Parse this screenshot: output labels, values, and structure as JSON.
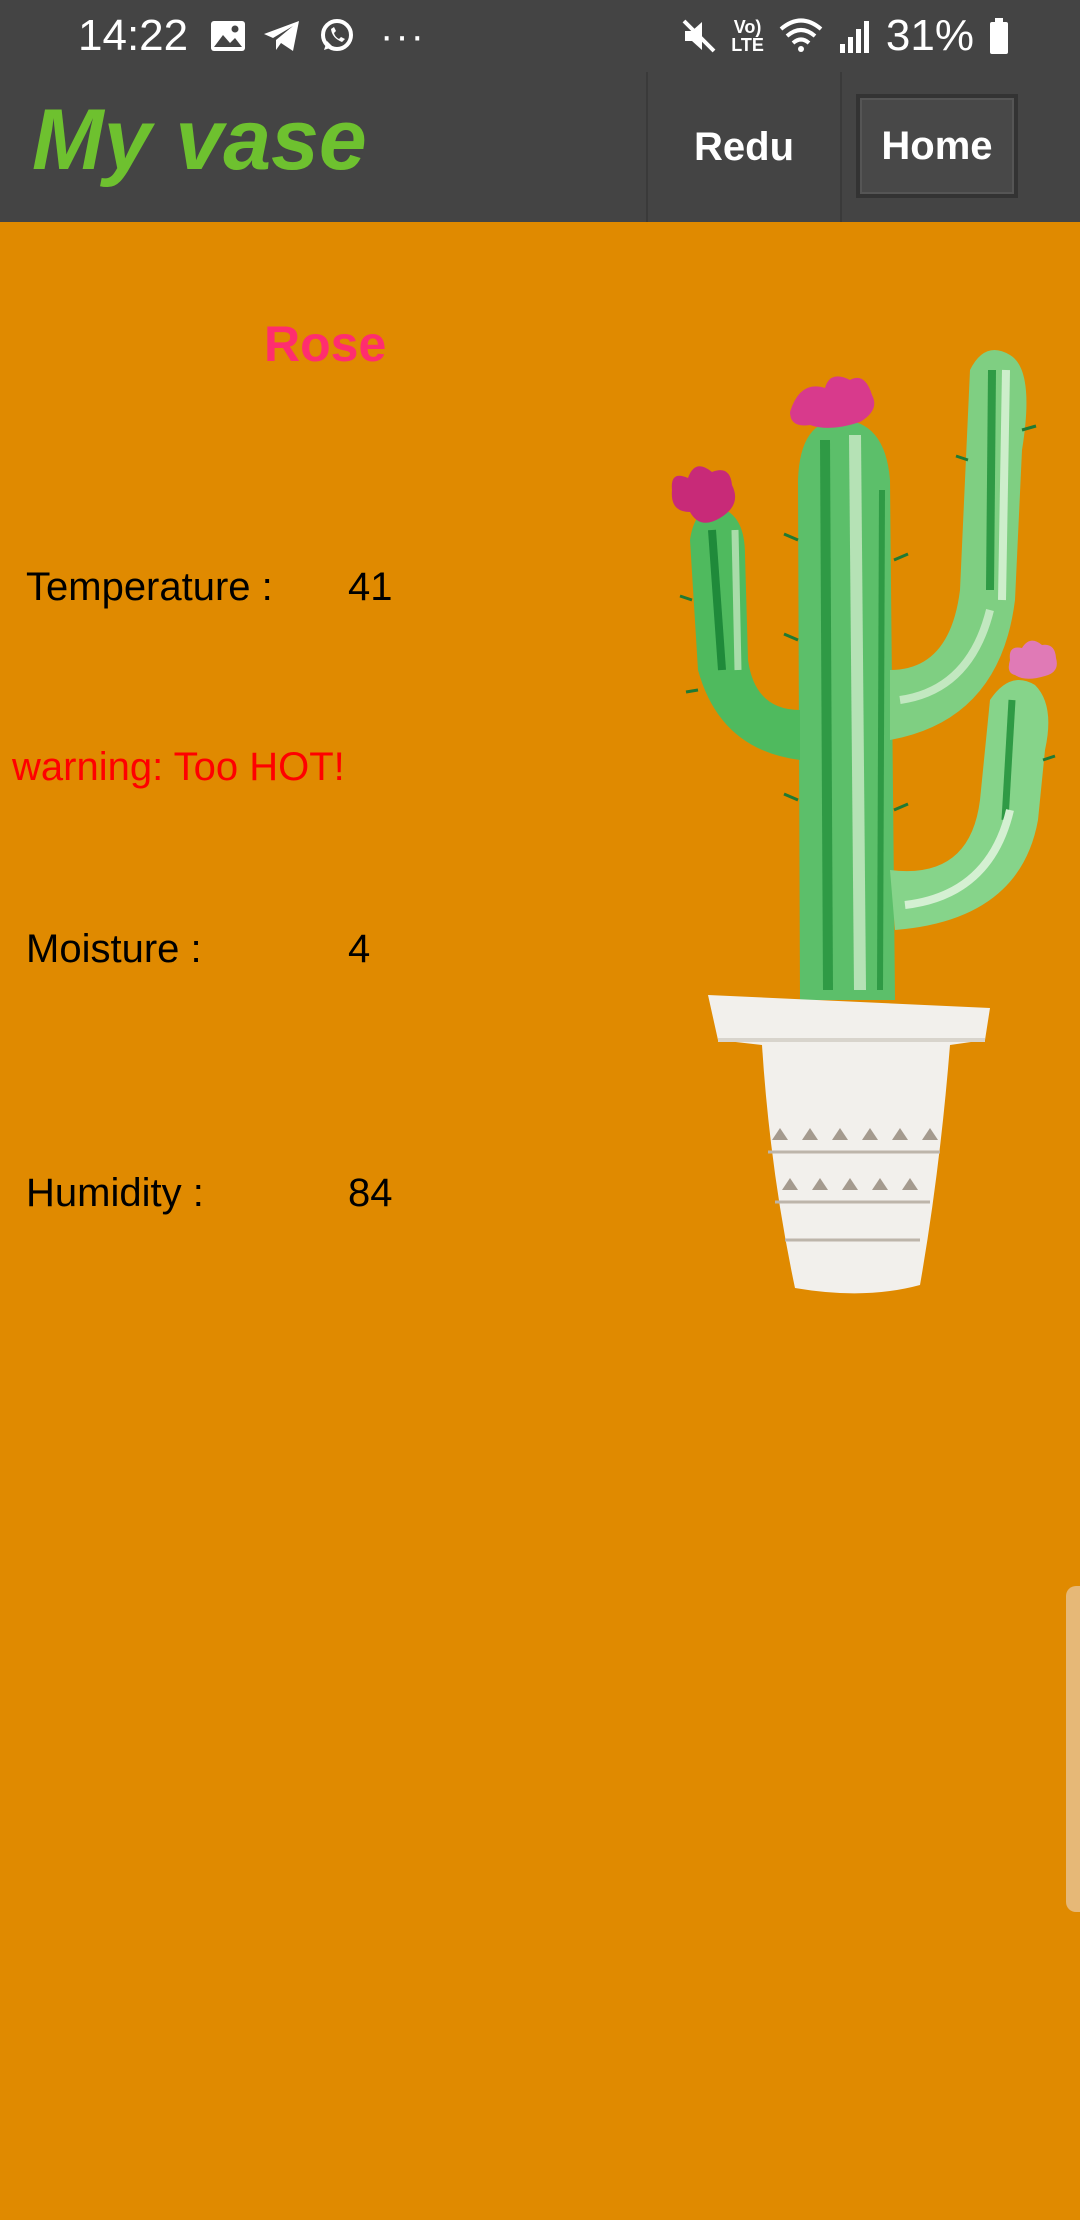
{
  "status_bar": {
    "time": "14:22",
    "left_icons": [
      "image-icon",
      "telegram-icon",
      "whatsapp-icon"
    ],
    "more": "···",
    "right_icons": [
      "mute-icon",
      "volte-icon",
      "wifi-icon",
      "signal-icon",
      "battery-icon"
    ],
    "volte_top": "Vo)",
    "volte_bottom": "LTE",
    "battery_percent": "31%"
  },
  "app_bar": {
    "title": "My vase",
    "buttons": [
      "Redu",
      "Home"
    ]
  },
  "plant": {
    "name": "Rose",
    "image": "cactus-in-pot-illustration"
  },
  "readings": [
    {
      "label": "Temperature :",
      "value": "41"
    },
    {
      "label": "Moisture :",
      "value": "4"
    },
    {
      "label": "Humidity :",
      "value": "84"
    }
  ],
  "warning": "warning: Too HOT!",
  "colors": {
    "background": "#e08a00",
    "bar": "#444444",
    "title": "#6ec12f",
    "plant_name": "#ff2d6f",
    "warning": "#ff0000"
  }
}
